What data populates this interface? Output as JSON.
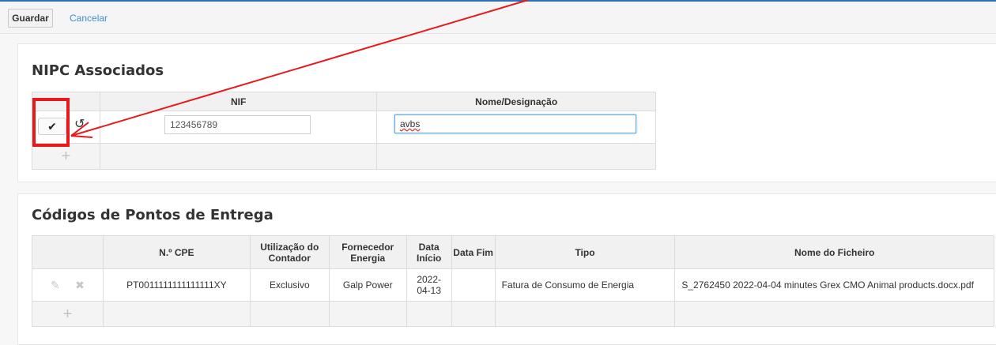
{
  "toolbar": {
    "save_label": "Guardar",
    "cancel_label": "Cancelar"
  },
  "nipc": {
    "title": "NIPC Associados",
    "columns": [
      "",
      "NIF",
      "Nome/Designação"
    ],
    "row": {
      "nif_value": "123456789",
      "nome_value": "avbs"
    },
    "icons": {
      "confirm": "check-icon",
      "undo": "undo-icon",
      "add": "plus-icon"
    }
  },
  "cpe": {
    "title": "Códigos de Pontos de Entrega",
    "columns": [
      "",
      "N.º CPE",
      "Utilização do Contador",
      "Fornecedor Energia",
      "Data Início",
      "Data Fim",
      "Tipo",
      "Nome do Ficheiro"
    ],
    "rows": [
      {
        "cpe": "PT0011111111111111XY",
        "utilizacao": "Exclusivo",
        "fornecedor": "Galp Power",
        "data_inicio": "2022-04-13",
        "data_fim": "",
        "tipo": "Fatura de Consumo de Energia",
        "ficheiro": "S_2762450 2022-04-04 minutes Grex CMO Animal products.docx.pdf"
      }
    ],
    "icons": {
      "edit": "pencil-icon",
      "delete": "close-icon",
      "add": "plus-icon"
    }
  },
  "colors": {
    "accent": "#2f6fb3",
    "link": "#3d8fd1",
    "annotation": "#e8191b"
  }
}
